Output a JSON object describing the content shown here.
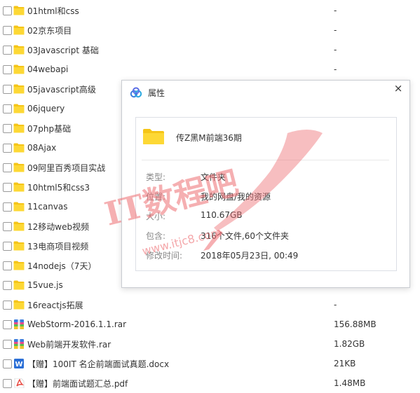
{
  "files": [
    {
      "name": "01html和css",
      "size": "-",
      "type": "folder"
    },
    {
      "name": "02京东项目",
      "size": "-",
      "type": "folder"
    },
    {
      "name": "03Javascript 基础",
      "size": "-",
      "type": "folder"
    },
    {
      "name": "04webapi",
      "size": "-",
      "type": "folder"
    },
    {
      "name": "05javascript高级",
      "size": "",
      "type": "folder"
    },
    {
      "name": "06jquery",
      "size": "",
      "type": "folder"
    },
    {
      "name": "07php基础",
      "size": "",
      "type": "folder"
    },
    {
      "name": "08Ajax",
      "size": "",
      "type": "folder"
    },
    {
      "name": "09阿里百秀项目实战",
      "size": "",
      "type": "folder"
    },
    {
      "name": "10html5和css3",
      "size": "",
      "type": "folder"
    },
    {
      "name": "11canvas",
      "size": "",
      "type": "folder"
    },
    {
      "name": "12移动web视频",
      "size": "",
      "type": "folder"
    },
    {
      "name": "13电商项目视频",
      "size": "",
      "type": "folder"
    },
    {
      "name": "14nodejs（7天）",
      "size": "",
      "type": "folder"
    },
    {
      "name": "15vue.js",
      "size": "",
      "type": "folder"
    },
    {
      "name": "16reactjs拓展",
      "size": "-",
      "type": "folder"
    },
    {
      "name": "WebStorm-2016.1.1.rar",
      "size": "156.88MB",
      "type": "rar"
    },
    {
      "name": "Web前端开发软件.rar",
      "size": "1.82GB",
      "type": "rar"
    },
    {
      "name": "【赠】100IT 名企前端面试真题.docx",
      "size": "21KB",
      "type": "docx"
    },
    {
      "name": "【赠】前端面试题汇总.pdf",
      "size": "1.48MB",
      "type": "pdf"
    }
  ],
  "dialog": {
    "title": "属性",
    "close_icon": "×",
    "folder_name": "传Z黑M前端36期",
    "props": [
      {
        "label": "类型:",
        "value": "文件夹"
      },
      {
        "label": "位置:",
        "value": "我的网盘/我的资源"
      },
      {
        "label": "大小:",
        "value": "110.67GB"
      },
      {
        "label": "包含:",
        "value": "316个文件,60个文件夹"
      },
      {
        "label": "修改时间:",
        "value": "2018年05月23日, 00:49"
      }
    ]
  },
  "watermark": {
    "brand": "IT数程吧",
    "url": "www.itjc8.com"
  },
  "colors": {
    "folder": "#f5c518",
    "rar_blue": "#3b7ddd",
    "docx": "#2b6fd6",
    "pdf": "#e8453c",
    "watermark": "#ee6e73"
  }
}
